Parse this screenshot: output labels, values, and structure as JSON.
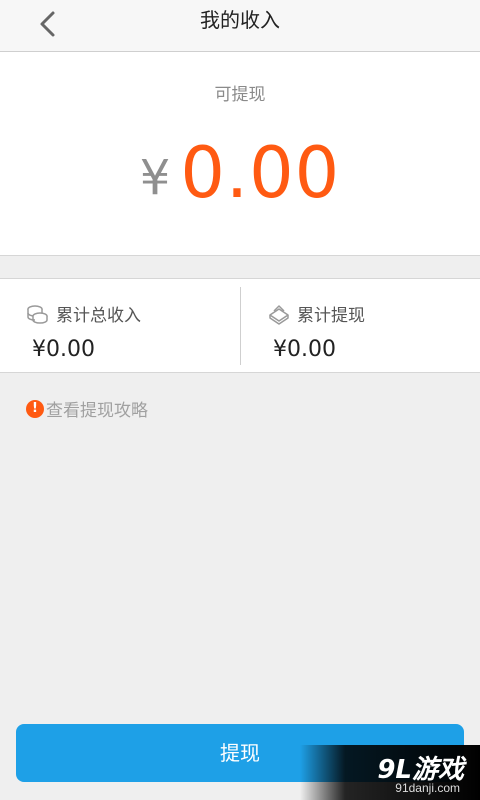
{
  "header": {
    "title": "我的收入",
    "back_icon": "chevron-left-icon"
  },
  "balance": {
    "label": "可提现",
    "currency": "¥",
    "amount": "0.00"
  },
  "stats": {
    "total_income": {
      "label": "累计总收入",
      "value": "¥0.00",
      "icon": "coins-icon"
    },
    "total_withdrawn": {
      "label": "累计提现",
      "value": "¥0.00",
      "icon": "money-stack-icon"
    }
  },
  "tips": {
    "icon_glyph": "!",
    "label": "查看提现攻略"
  },
  "action": {
    "withdraw_label": "提现"
  },
  "watermark": {
    "logo": "9L游戏",
    "url": "91danji.com"
  },
  "colors": {
    "accent": "#ff5a12",
    "primary_button": "#1ea0e7"
  }
}
